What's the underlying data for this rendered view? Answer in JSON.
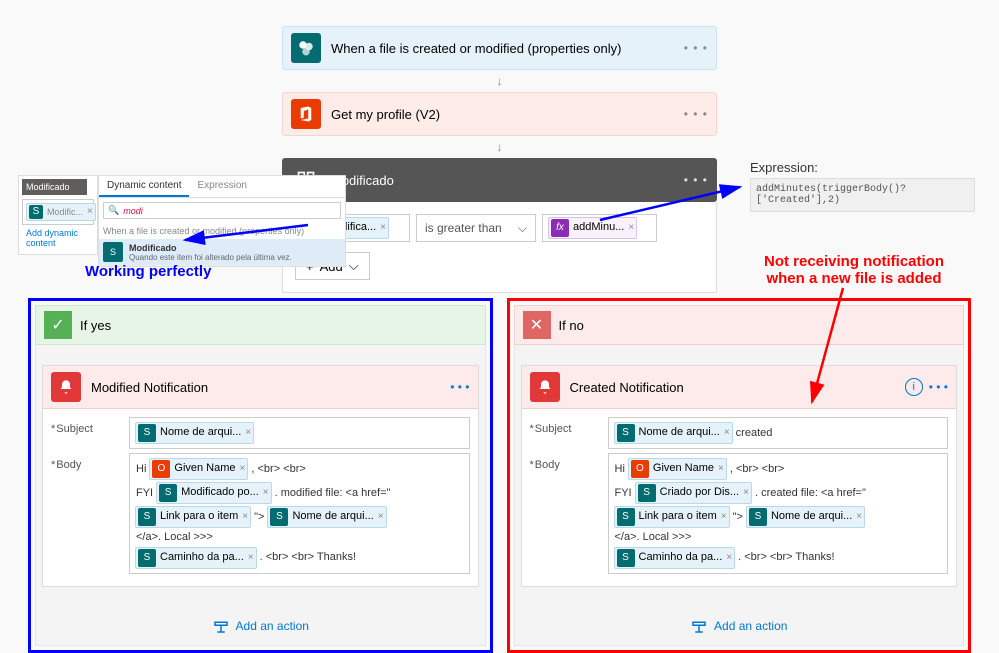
{
  "trigger": {
    "title": "When a file is created or modified (properties only)"
  },
  "profile": {
    "title": "Get my profile (V2)"
  },
  "condition": {
    "title": "Modificado",
    "left_pill": "Modifica...",
    "operator": "is greater than",
    "right_pill": "addMinu...",
    "add_label": "Add"
  },
  "expression": {
    "label": "Expression:",
    "value": "addMinutes(triggerBody()?['Created'],2)"
  },
  "popup": {
    "bar": "Modificado",
    "tab_dynamic": "Dynamic content",
    "tab_expr": "Expression",
    "search": "modi",
    "group": "When a file is created or modified (properties only)",
    "item_title": "Modificado",
    "item_sub": "Quando este item foi alterado pela última vez.",
    "link": "Add dynamic content",
    "left_pill": "Modific..."
  },
  "yes_label": "If yes",
  "no_label": "If no",
  "modified_notif": {
    "title": "Modified Notification",
    "subject_label": "Subject",
    "body_label": "Body",
    "pill_nome": "Nome de arqui...",
    "hi": "Hi",
    "pill_given": "Given Name",
    "br": ", <br> <br>",
    "fyi": "FYI",
    "pill_modby": "Modificado po...",
    "modfile": ". modified file: <a href=\"",
    "pill_link": "Link para o item",
    "quote": "\">",
    "pill_nome2": "Nome de arqui...",
    "local": "</a>. Local >>>",
    "pill_caminho": "Caminho da pa...",
    "thanks": ". <br> <br> Thanks!"
  },
  "created_notif": {
    "title": "Created Notification",
    "subject_label": "Subject",
    "body_label": "Body",
    "pill_nome": "Nome de arqui...",
    "created_txt": "created",
    "hi": "Hi",
    "pill_given": "Given Name",
    "br": ", <br> <br>",
    "fyi": "FYI",
    "pill_crby": "Criado por Dis...",
    "crfile": ". created file: <a href=\"",
    "pill_link": "Link para o item",
    "quote": "\">",
    "pill_nome2": "Nome de arqui...",
    "local": "</a>. Local >>>",
    "pill_caminho": "Caminho da pa...",
    "thanks": ". <br> <br> Thanks!"
  },
  "add_action": "Add an action",
  "annot_left": "Working perfectly",
  "annot_right_l1": "Not receiving notification",
  "annot_right_l2": "when a new file is added"
}
